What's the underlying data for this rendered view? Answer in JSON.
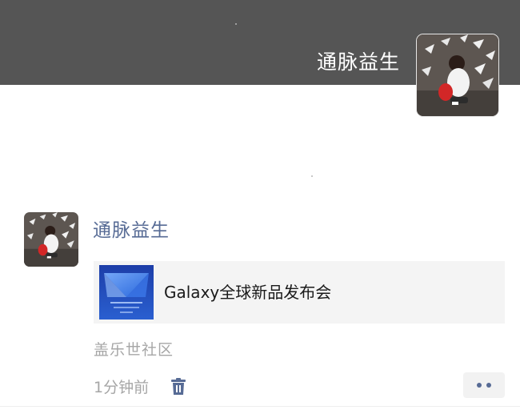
{
  "cover": {
    "name": "通脉益生",
    "avatar_icon": "user-avatar-photo",
    "background_color": "#555555"
  },
  "post": {
    "author": "通脉益生",
    "author_color": "#576b95",
    "avatar_icon": "user-avatar-photo",
    "link_card": {
      "title": "Galaxy全球新品发布会",
      "thumbnail_icon": "galaxy-event-thumbnail"
    },
    "location": "盖乐世社区",
    "time": "1分钟前",
    "delete_icon": "trash-icon",
    "more_icon": "more-dots-icon"
  }
}
